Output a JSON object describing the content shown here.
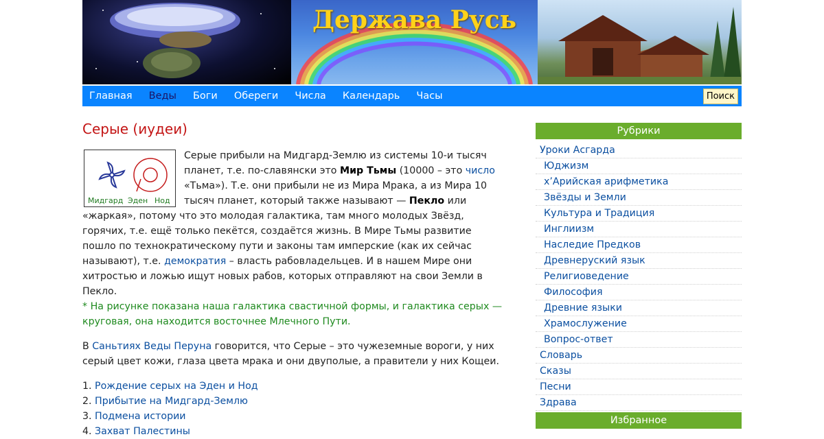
{
  "header": {
    "site_title": "Держава Русь"
  },
  "nav": {
    "items": [
      {
        "label": "Главная",
        "active": false
      },
      {
        "label": "Веды",
        "active": true
      },
      {
        "label": "Боги",
        "active": false
      },
      {
        "label": "Обереги",
        "active": false
      },
      {
        "label": "Числа",
        "active": false
      },
      {
        "label": "Календарь",
        "active": false
      },
      {
        "label": "Часы",
        "active": false
      }
    ],
    "search_label": "Поиск"
  },
  "article": {
    "title": "Серые (иудеи)",
    "figure_labels": [
      "Мидгард",
      "Эден",
      "Нод"
    ],
    "p1_a": "Серые прибыли на Мидгард-Землю из системы 10-и тысяч планет, т.е. по-славянски это ",
    "p1_b": "Мир Тьмы",
    "p1_c": " (10000 – это ",
    "p1_link": "число",
    "p1_d": " «Тьма»). Т.е. они прибыли не из Мира Мрака, а из Мира 10 тысяч планет, который также называют — ",
    "p1_e": "Пекло",
    "p1_f": " или «жаркая», потому что это молодая галактика, там много молодых Звёзд, горячих, т.е. ещё только пекётся, создаётся жизнь. В Мире Тьмы развитие пошло по технократическому пути и законы там имперские (как их сейчас называют), т.е. ",
    "p1_link2": "демократия",
    "p1_g": " – власть рабовладельцев. И в нашем Мире они хитростью и ложью ищут новых рабов, которых отправляют на свои Земли в Пекло.",
    "note": "* На рисунке показана наша галактика свастичной формы, и галактика серых — круговая, она находится восточнее Млечного Пути.",
    "p2_a": "В ",
    "p2_link": "Саньтиях Веды Перуна",
    "p2_b": " говорится, что Серые – это чужеземные вороги, у них серый цвет кожи, глаза цвета мрака и они двуполые, а правители у них Кощеи.",
    "list": [
      {
        "num": "1. ",
        "label": "Рождение серых на Эден и Нод"
      },
      {
        "num": "2. ",
        "label": "Прибытие на Мидгард-Землю"
      },
      {
        "num": "3. ",
        "label": "Подмена истории"
      },
      {
        "num": "4. ",
        "label": "Захват Палестины"
      }
    ]
  },
  "sidebar": {
    "heading": "Рубрики",
    "items": [
      {
        "label": "Уроки Асгарда",
        "level": "top"
      },
      {
        "label": "Юджизм",
        "level": "sub"
      },
      {
        "label": "х’Арийская арифметика",
        "level": "sub"
      },
      {
        "label": "Звёзды и Земли",
        "level": "sub"
      },
      {
        "label": "Культура и Традиция",
        "level": "sub"
      },
      {
        "label": "Инглиизм",
        "level": "sub"
      },
      {
        "label": "Наследие Предков",
        "level": "sub"
      },
      {
        "label": "Древнеруский язык",
        "level": "sub"
      },
      {
        "label": "Религиоведение",
        "level": "sub"
      },
      {
        "label": "Философия",
        "level": "sub"
      },
      {
        "label": "Древние языки",
        "level": "sub"
      },
      {
        "label": "Храмослужение",
        "level": "sub"
      },
      {
        "label": "Вопрос-ответ",
        "level": "sub"
      },
      {
        "label": "Словарь",
        "level": "top"
      },
      {
        "label": "Сказы",
        "level": "top"
      },
      {
        "label": "Песни",
        "level": "top"
      },
      {
        "label": "Здрава",
        "level": "top"
      }
    ],
    "heading2": "Избранное"
  },
  "colors": {
    "nav_bg": "#0a84ff",
    "title_red": "#c31414",
    "sidebar_green": "#6aad2c",
    "link_blue": "#0b4fa0",
    "note_green": "#1f8a1f",
    "site_title_gold": "#ffd21a"
  }
}
